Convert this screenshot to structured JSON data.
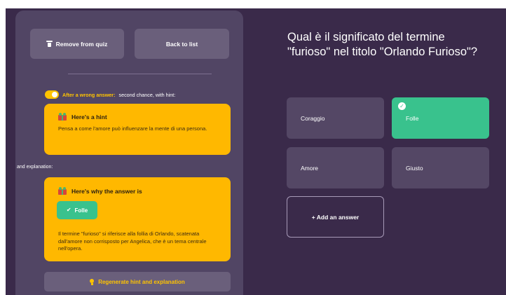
{
  "toolbar": {
    "remove_label": "Remove from quiz",
    "back_label": "Back to list"
  },
  "toggle": {
    "on": true,
    "label_highlight": "After a wrong answer:",
    "label_rest": "second chance, with hint:"
  },
  "hint": {
    "title": "Here's a hint",
    "body": "Pensa a come l'amore può influenzare la mente di una persona."
  },
  "explanation_label": "and explanation:",
  "why": {
    "title": "Here's why the answer is",
    "answer": "Folle",
    "body": "Il termine \"furioso\" si riferisce alla follia di Orlando, scatenata dall'amore non corrisposto per Angelica, che è un tema centrale nell'opera."
  },
  "regenerate_label": "Regenerate hint and explanation",
  "question": "Qual è il significato del termine \"furioso\" nel titolo \"Orlando Furioso\"?",
  "answers": [
    {
      "label": "Coraggio",
      "correct": false
    },
    {
      "label": "Folle",
      "correct": true
    },
    {
      "label": "Amore",
      "correct": false
    },
    {
      "label": "Giusto",
      "correct": false
    }
  ],
  "add_answer_label": "+ Add an answer",
  "colors": {
    "background": "#3a2a4a",
    "panel": "#514564",
    "button": "#6a5f7b",
    "accent_yellow": "#ffb800",
    "correct_green": "#39c28d"
  },
  "icons": [
    "trash-icon",
    "gift-icon",
    "check-icon",
    "lightbulb-icon",
    "check-circle-icon"
  ]
}
